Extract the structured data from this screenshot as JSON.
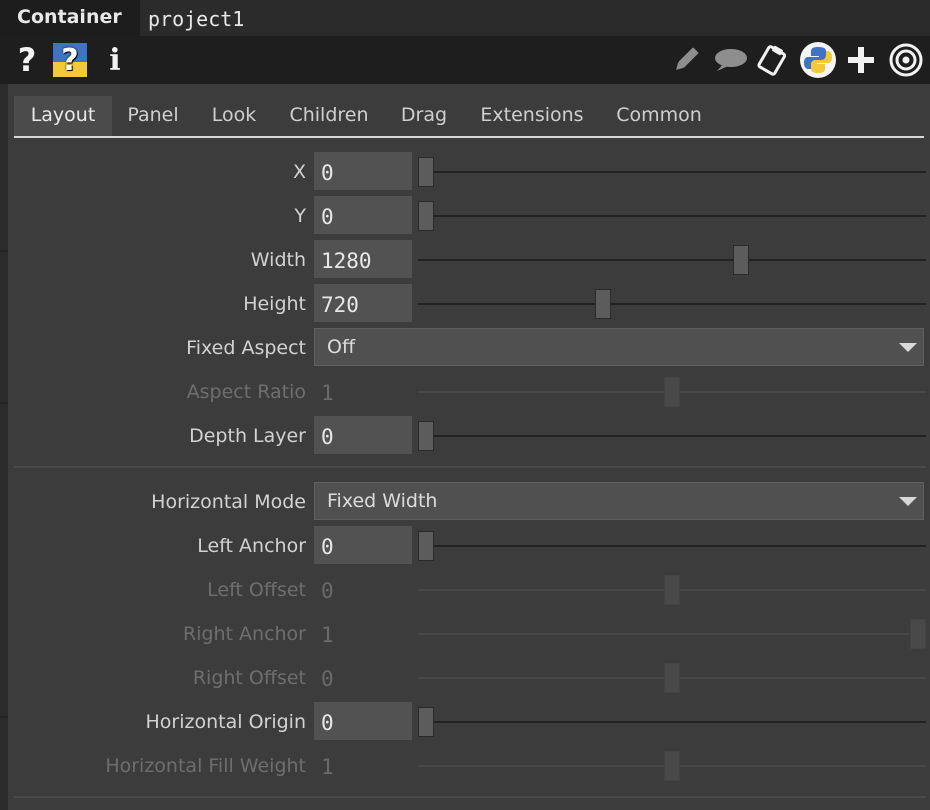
{
  "window": {
    "op_type": "Container",
    "op_name": "project1"
  },
  "toolbar": {
    "help_label": "?",
    "python_help_label": "?",
    "info_label": "i",
    "icons": [
      "help-icon",
      "python-help-icon",
      "info-icon",
      "pencil-icon",
      "comment-icon",
      "clipboard-icon",
      "python-icon",
      "plus-icon",
      "target-icon"
    ]
  },
  "tabs": [
    {
      "label": "Layout",
      "active": true
    },
    {
      "label": "Panel",
      "active": false
    },
    {
      "label": "Look",
      "active": false
    },
    {
      "label": "Children",
      "active": false
    },
    {
      "label": "Drag",
      "active": false
    },
    {
      "label": "Extensions",
      "active": false
    },
    {
      "label": "Common",
      "active": false
    }
  ],
  "params": {
    "x": {
      "label": "X",
      "value": "0",
      "slider_fraction": 0.0
    },
    "y": {
      "label": "Y",
      "value": "0",
      "slider_fraction": 0.0
    },
    "width": {
      "label": "Width",
      "value": "1280",
      "slider_fraction": 0.64
    },
    "height": {
      "label": "Height",
      "value": "720",
      "slider_fraction": 0.36
    },
    "fixed_aspect": {
      "label": "Fixed Aspect",
      "value": "Off"
    },
    "aspect_ratio": {
      "label": "Aspect Ratio",
      "value": "1",
      "slider_fraction": 0.5,
      "enabled": false
    },
    "depth_layer": {
      "label": "Depth Layer",
      "value": "0",
      "slider_fraction": 0.0
    },
    "horizontal_mode": {
      "label": "Horizontal Mode",
      "value": "Fixed Width"
    },
    "left_anchor": {
      "label": "Left Anchor",
      "value": "0",
      "slider_fraction": 0.0
    },
    "left_offset": {
      "label": "Left Offset",
      "value": "0",
      "slider_fraction": 0.5,
      "enabled": false
    },
    "right_anchor": {
      "label": "Right Anchor",
      "value": "1",
      "slider_fraction": 1.0,
      "enabled": false
    },
    "right_offset": {
      "label": "Right Offset",
      "value": "0",
      "slider_fraction": 0.5,
      "enabled": false
    },
    "horizontal_origin": {
      "label": "Horizontal Origin",
      "value": "0",
      "slider_fraction": 0.0
    },
    "horizontal_fill_weight": {
      "label": "Horizontal Fill Weight",
      "value": "1",
      "slider_fraction": 0.5,
      "enabled": false
    }
  },
  "colors": {
    "panel_bg": "#3c3c3c",
    "toolbar_bg": "#1e1e1e",
    "field_bg": "#525252",
    "python_blue": "#3f74c4",
    "python_yellow": "#f1c93a"
  }
}
